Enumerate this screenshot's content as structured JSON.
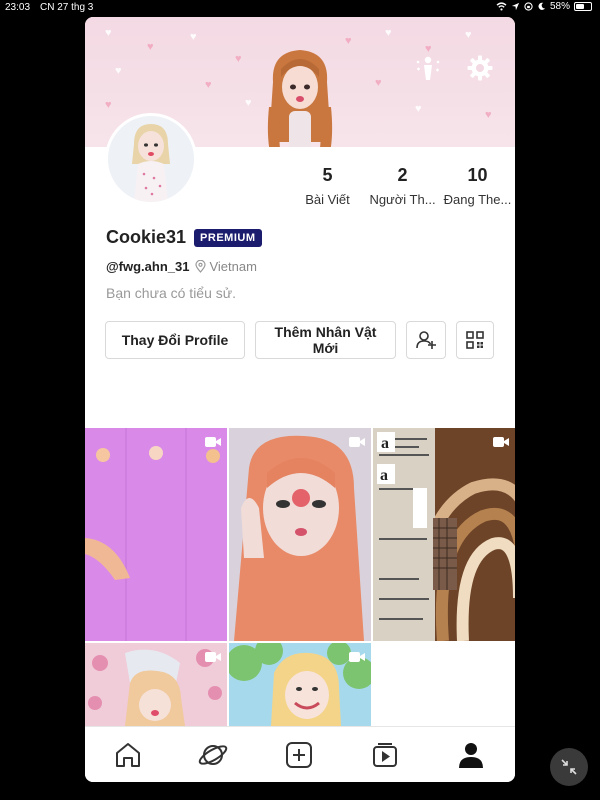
{
  "status": {
    "time": "23:03",
    "date": "CN 27 thg 3",
    "battery": "58%",
    "battery_level": 0.58
  },
  "profile": {
    "name": "Cookie31",
    "badge": "PREMIUM",
    "handle": "@fwg.ahn_31",
    "location": "Vietnam",
    "bio": "Bạn chưa có tiểu sử."
  },
  "stats": [
    {
      "value": "5",
      "label": "Bài Viết"
    },
    {
      "value": "2",
      "label": "Người Th..."
    },
    {
      "value": "10",
      "label": "Đang The..."
    }
  ],
  "actions": {
    "edit_profile": "Thay Đổi Profile",
    "new_character": "Thêm Nhân Vật Mới"
  },
  "icons": {
    "header": [
      "avatar-pose-icon",
      "gear-icon"
    ],
    "tabs": [
      "home-icon",
      "planet-icon",
      "plus-square-icon",
      "video-play-icon",
      "profile-icon"
    ]
  },
  "colors": {
    "premium_bg": "#1c1c6e",
    "banner": "#f3d9e3"
  }
}
